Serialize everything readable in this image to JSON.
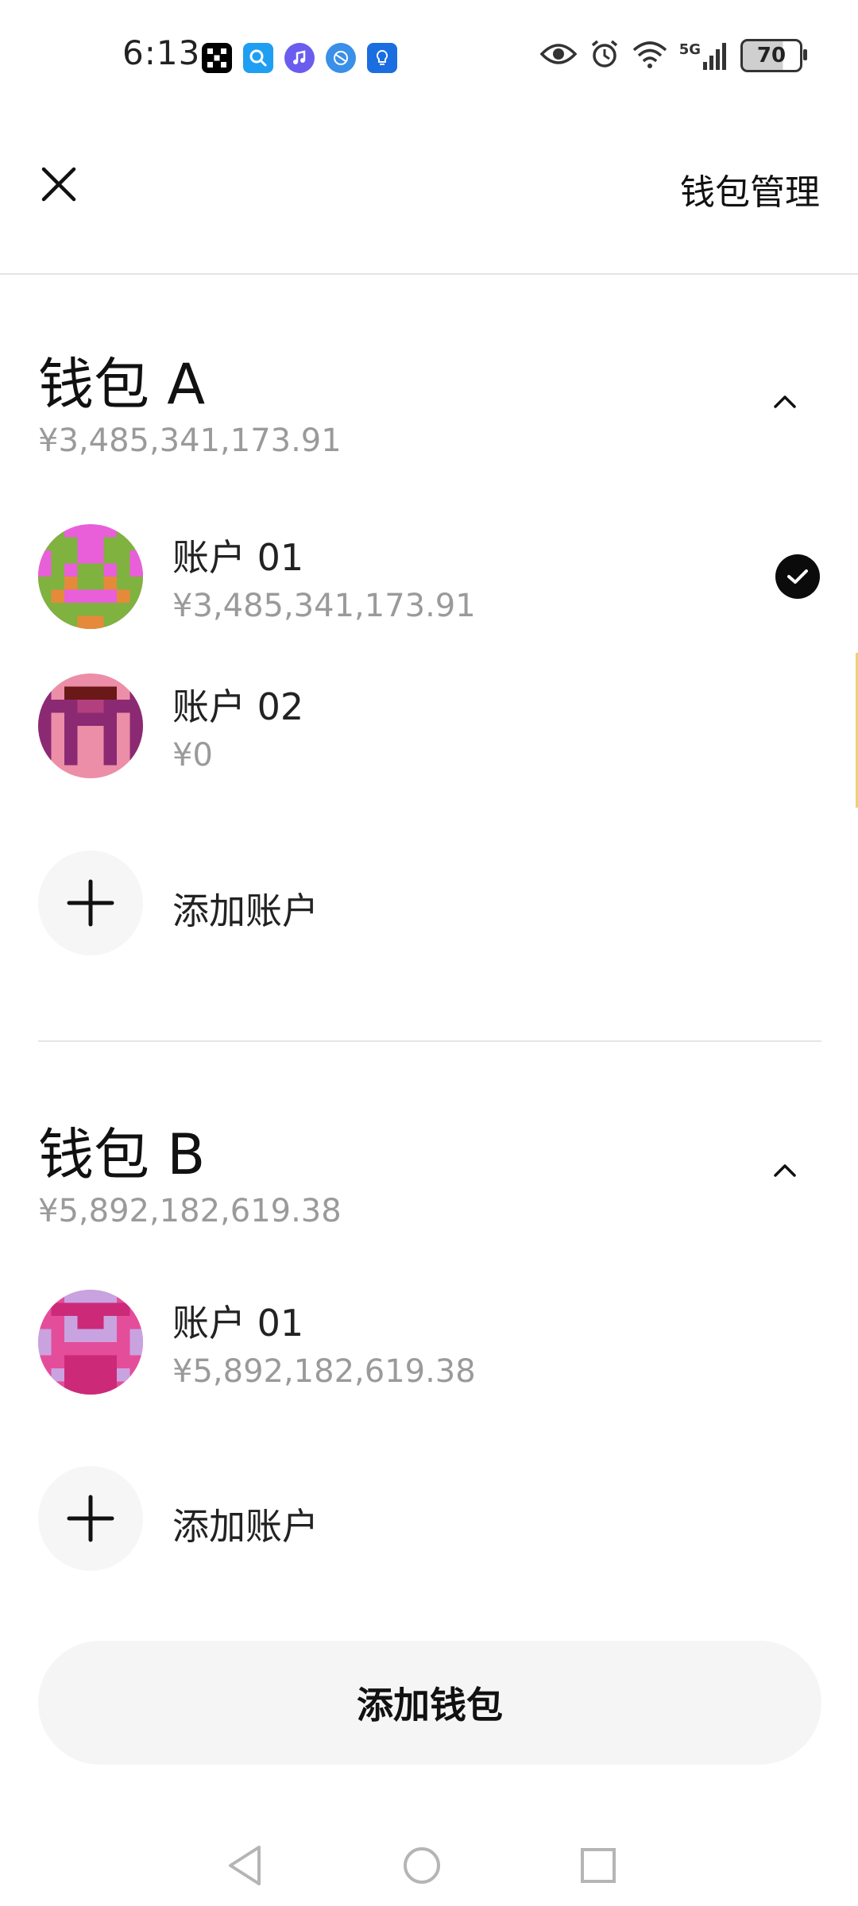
{
  "status_bar": {
    "time": "6:13",
    "battery": "70",
    "network": "5G",
    "app_icons": [
      "okx-icon",
      "search-app-icon",
      "music-app-icon",
      "browser-app-icon",
      "bulb-app-icon"
    ]
  },
  "header": {
    "manage_label": "钱包管理"
  },
  "wallets": [
    {
      "name": "钱包 A",
      "total": "¥3,485,341,173.91",
      "accounts": [
        {
          "name": "账户 01",
          "balance": "¥3,485,341,173.91",
          "selected": true
        },
        {
          "name": "账户 02",
          "balance": "¥0",
          "selected": false
        }
      ],
      "add_account_label": "添加账户"
    },
    {
      "name": "钱包 B",
      "total": "¥5,892,182,619.38",
      "accounts": [
        {
          "name": "账户 01",
          "balance": "¥5,892,182,619.38",
          "selected": false
        }
      ],
      "add_account_label": "添加账户"
    }
  ],
  "add_wallet_label": "添加钱包",
  "colors": {
    "accent_black": "#0b0b0b",
    "secondary_text": "#9a9a9a",
    "button_bg": "#f5f5f5"
  }
}
